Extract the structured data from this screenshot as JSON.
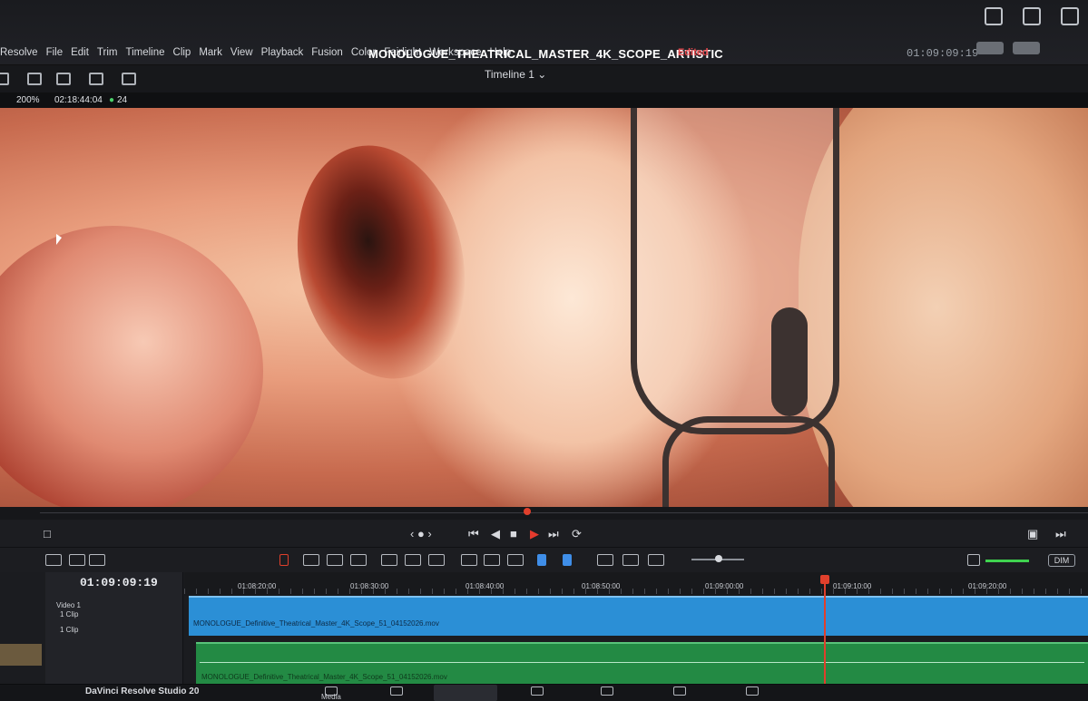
{
  "app": {
    "menu": [
      "Resolve",
      "File",
      "Edit",
      "Trim",
      "Timeline",
      "Clip",
      "Mark",
      "View",
      "Playback",
      "Fusion",
      "Color",
      "Fairlight",
      "Workspace",
      "Help"
    ],
    "project_title": "MONOLOGUE_THEATRICAL_MASTER_4K_SCOPE_ARTISTIC",
    "edited_badge": "Edited",
    "timecode_top": "01:09:09:19",
    "brand": "DaVinci Resolve Studio 20"
  },
  "viewer": {
    "timeline_name": "Timeline 1 ⌄",
    "zoom": "200%",
    "duration": "02:18:44:04",
    "fps": "24"
  },
  "timeline": {
    "current_timecode": "01:09:09:19",
    "ruler_labels": [
      "01:08:20:00",
      "01:08:30:00",
      "01:08:40:00",
      "01:08:50:00",
      "01:09:00:00",
      "01:09:10:00",
      "01:09:20:00"
    ],
    "video_track_label": "Video 1",
    "video_track_clips": "1 Clip",
    "audio_track_clips": "1 Clip",
    "video_clip_name": "MONOLOGUE_Definitive_Theatrical_Master_4K_Scope_51_04152026.mov",
    "audio_clip_name": "MONOLOGUE_Definitive_Theatrical_Master_4K_Scope_51_04152026.mov"
  },
  "transport": {
    "jog": "‹ ● ›",
    "dim_label": "DIM"
  },
  "page_tabs": {
    "media_label": "Media"
  },
  "colors": {
    "accent_red": "#e0402c",
    "video_clip": "#2b8fd6",
    "audio_clip": "#238a44"
  }
}
